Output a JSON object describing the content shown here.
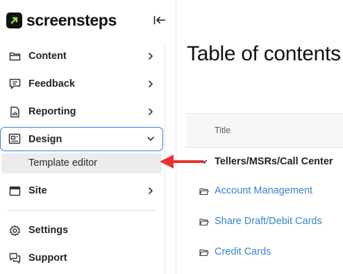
{
  "app": {
    "brand": "screensteps",
    "accent_color": "#3b7ddd",
    "logo_color": "#111111"
  },
  "sidebar": {
    "collapse_icon": "collapse-sidebar-icon",
    "items": [
      {
        "label": "Content",
        "icon": "folder-icon"
      },
      {
        "label": "Feedback",
        "icon": "chat-bubble-icon"
      },
      {
        "label": "Reporting",
        "icon": "chart-document-icon"
      },
      {
        "label": "Design",
        "icon": "layout-icon",
        "expanded": true,
        "children": [
          {
            "label": "Template editor"
          }
        ]
      },
      {
        "label": "Site",
        "icon": "browser-window-icon"
      },
      {
        "label": "Settings",
        "icon": "gear-icon"
      },
      {
        "label": "Support",
        "icon": "support-chat-icon"
      }
    ]
  },
  "main": {
    "title": "Table of contents",
    "table": {
      "column_title": "Title",
      "rows": [
        {
          "label": "Tellers/MSRs/Call Center",
          "type": "chapter",
          "icon": "chevron-down-icon"
        },
        {
          "label": "Account Management",
          "type": "folder",
          "icon": "folder-open-icon"
        },
        {
          "label": "Share Draft/Debit Cards",
          "type": "folder",
          "icon": "folder-open-icon"
        },
        {
          "label": "Credit Cards",
          "type": "folder",
          "icon": "folder-open-icon"
        }
      ]
    }
  },
  "annotation": {
    "arrow_color": "#e8312f",
    "arrow_icon": "red-pointer-arrow"
  }
}
